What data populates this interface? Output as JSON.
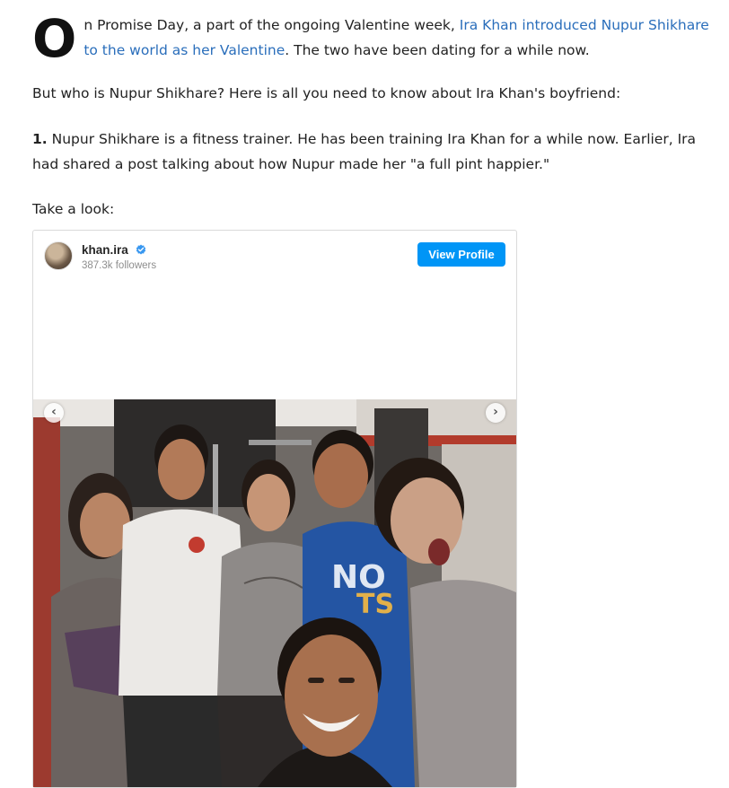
{
  "article": {
    "p1": {
      "dropcap": "O",
      "text_before": "n Promise Day, a part of the ongoing Valentine week, ",
      "link_text": "Ira Khan introduced Nupur Shikhare to the world as her Valentine",
      "text_after": ". The two have been dating for a while now."
    },
    "p2": "But who is Nupur Shikhare? Here is all you need to know about Ira Khan's boyfriend:",
    "p3": {
      "number": "1.",
      "text": " Nupur Shikhare is a fitness trainer. He has been training Ira Khan for a while now. Earlier, Ira had shared a post talking about how Nupur made her \"a full pint happier.\""
    },
    "p4": "Take a look:"
  },
  "embed": {
    "username": "khan.ira",
    "followers": "387.3k followers",
    "view_profile_label": "View Profile",
    "prev_icon": "chevron-left-icon",
    "next_icon": "chevron-right-icon",
    "photo_shirt_text": "NO",
    "photo_shirt_text_2": "TS"
  },
  "colors": {
    "link": "#2a6ebb",
    "button": "#0095f6",
    "verified": "#3897f0"
  }
}
